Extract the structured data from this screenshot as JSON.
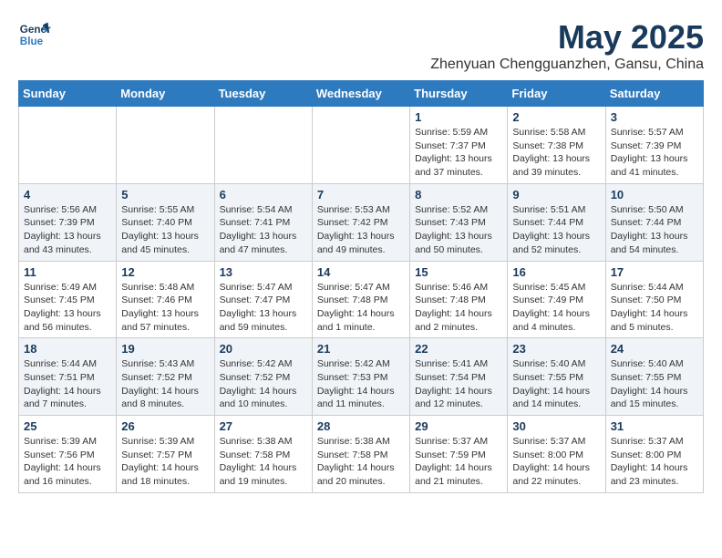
{
  "logo": {
    "line1": "General",
    "line2": "Blue"
  },
  "title": "May 2025",
  "location": "Zhenyuan Chengguanzhen, Gansu, China",
  "weekdays": [
    "Sunday",
    "Monday",
    "Tuesday",
    "Wednesday",
    "Thursday",
    "Friday",
    "Saturday"
  ],
  "weeks": [
    [
      {
        "day": "",
        "info": ""
      },
      {
        "day": "",
        "info": ""
      },
      {
        "day": "",
        "info": ""
      },
      {
        "day": "",
        "info": ""
      },
      {
        "day": "1",
        "info": "Sunrise: 5:59 AM\nSunset: 7:37 PM\nDaylight: 13 hours\nand 37 minutes."
      },
      {
        "day": "2",
        "info": "Sunrise: 5:58 AM\nSunset: 7:38 PM\nDaylight: 13 hours\nand 39 minutes."
      },
      {
        "day": "3",
        "info": "Sunrise: 5:57 AM\nSunset: 7:39 PM\nDaylight: 13 hours\nand 41 minutes."
      }
    ],
    [
      {
        "day": "4",
        "info": "Sunrise: 5:56 AM\nSunset: 7:39 PM\nDaylight: 13 hours\nand 43 minutes."
      },
      {
        "day": "5",
        "info": "Sunrise: 5:55 AM\nSunset: 7:40 PM\nDaylight: 13 hours\nand 45 minutes."
      },
      {
        "day": "6",
        "info": "Sunrise: 5:54 AM\nSunset: 7:41 PM\nDaylight: 13 hours\nand 47 minutes."
      },
      {
        "day": "7",
        "info": "Sunrise: 5:53 AM\nSunset: 7:42 PM\nDaylight: 13 hours\nand 49 minutes."
      },
      {
        "day": "8",
        "info": "Sunrise: 5:52 AM\nSunset: 7:43 PM\nDaylight: 13 hours\nand 50 minutes."
      },
      {
        "day": "9",
        "info": "Sunrise: 5:51 AM\nSunset: 7:44 PM\nDaylight: 13 hours\nand 52 minutes."
      },
      {
        "day": "10",
        "info": "Sunrise: 5:50 AM\nSunset: 7:44 PM\nDaylight: 13 hours\nand 54 minutes."
      }
    ],
    [
      {
        "day": "11",
        "info": "Sunrise: 5:49 AM\nSunset: 7:45 PM\nDaylight: 13 hours\nand 56 minutes."
      },
      {
        "day": "12",
        "info": "Sunrise: 5:48 AM\nSunset: 7:46 PM\nDaylight: 13 hours\nand 57 minutes."
      },
      {
        "day": "13",
        "info": "Sunrise: 5:47 AM\nSunset: 7:47 PM\nDaylight: 13 hours\nand 59 minutes."
      },
      {
        "day": "14",
        "info": "Sunrise: 5:47 AM\nSunset: 7:48 PM\nDaylight: 14 hours\nand 1 minute."
      },
      {
        "day": "15",
        "info": "Sunrise: 5:46 AM\nSunset: 7:48 PM\nDaylight: 14 hours\nand 2 minutes."
      },
      {
        "day": "16",
        "info": "Sunrise: 5:45 AM\nSunset: 7:49 PM\nDaylight: 14 hours\nand 4 minutes."
      },
      {
        "day": "17",
        "info": "Sunrise: 5:44 AM\nSunset: 7:50 PM\nDaylight: 14 hours\nand 5 minutes."
      }
    ],
    [
      {
        "day": "18",
        "info": "Sunrise: 5:44 AM\nSunset: 7:51 PM\nDaylight: 14 hours\nand 7 minutes."
      },
      {
        "day": "19",
        "info": "Sunrise: 5:43 AM\nSunset: 7:52 PM\nDaylight: 14 hours\nand 8 minutes."
      },
      {
        "day": "20",
        "info": "Sunrise: 5:42 AM\nSunset: 7:52 PM\nDaylight: 14 hours\nand 10 minutes."
      },
      {
        "day": "21",
        "info": "Sunrise: 5:42 AM\nSunset: 7:53 PM\nDaylight: 14 hours\nand 11 minutes."
      },
      {
        "day": "22",
        "info": "Sunrise: 5:41 AM\nSunset: 7:54 PM\nDaylight: 14 hours\nand 12 minutes."
      },
      {
        "day": "23",
        "info": "Sunrise: 5:40 AM\nSunset: 7:55 PM\nDaylight: 14 hours\nand 14 minutes."
      },
      {
        "day": "24",
        "info": "Sunrise: 5:40 AM\nSunset: 7:55 PM\nDaylight: 14 hours\nand 15 minutes."
      }
    ],
    [
      {
        "day": "25",
        "info": "Sunrise: 5:39 AM\nSunset: 7:56 PM\nDaylight: 14 hours\nand 16 minutes."
      },
      {
        "day": "26",
        "info": "Sunrise: 5:39 AM\nSunset: 7:57 PM\nDaylight: 14 hours\nand 18 minutes."
      },
      {
        "day": "27",
        "info": "Sunrise: 5:38 AM\nSunset: 7:58 PM\nDaylight: 14 hours\nand 19 minutes."
      },
      {
        "day": "28",
        "info": "Sunrise: 5:38 AM\nSunset: 7:58 PM\nDaylight: 14 hours\nand 20 minutes."
      },
      {
        "day": "29",
        "info": "Sunrise: 5:37 AM\nSunset: 7:59 PM\nDaylight: 14 hours\nand 21 minutes."
      },
      {
        "day": "30",
        "info": "Sunrise: 5:37 AM\nSunset: 8:00 PM\nDaylight: 14 hours\nand 22 minutes."
      },
      {
        "day": "31",
        "info": "Sunrise: 5:37 AM\nSunset: 8:00 PM\nDaylight: 14 hours\nand 23 minutes."
      }
    ]
  ]
}
